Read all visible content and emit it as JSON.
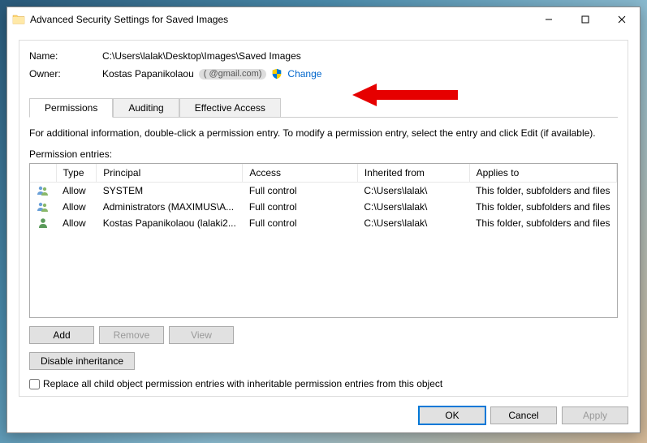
{
  "window": {
    "title": "Advanced Security Settings for Saved Images"
  },
  "name": {
    "label": "Name:",
    "value": "C:\\Users\\lalak\\Desktop\\Images\\Saved Images"
  },
  "owner": {
    "label": "Owner:",
    "value": "Kostas Papanikolaou",
    "email": "(           @gmail.com)",
    "change": "Change"
  },
  "tabs": {
    "permissions": "Permissions",
    "auditing": "Auditing",
    "effective": "Effective Access"
  },
  "instructions": "For additional information, double-click a permission entry. To modify a permission entry, select the entry and click Edit (if available).",
  "entries_label": "Permission entries:",
  "columns": {
    "type": "Type",
    "principal": "Principal",
    "access": "Access",
    "inherited": "Inherited from",
    "applies": "Applies to"
  },
  "entries": [
    {
      "type": "Allow",
      "principal": "SYSTEM",
      "access": "Full control",
      "inherited": "C:\\Users\\lalak\\",
      "applies": "This folder, subfolders and files",
      "icon": "group"
    },
    {
      "type": "Allow",
      "principal": "Administrators (MAXIMUS\\A...",
      "access": "Full control",
      "inherited": "C:\\Users\\lalak\\",
      "applies": "This folder, subfolders and files",
      "icon": "group"
    },
    {
      "type": "Allow",
      "principal": "Kostas Papanikolaou (lalaki2...",
      "access": "Full control",
      "inherited": "C:\\Users\\lalak\\",
      "applies": "This folder, subfolders and files",
      "icon": "user"
    }
  ],
  "buttons": {
    "add": "Add",
    "remove": "Remove",
    "view": "View",
    "disable_inherit": "Disable inheritance",
    "ok": "OK",
    "cancel": "Cancel",
    "apply": "Apply"
  },
  "checkbox_label": "Replace all child object permission entries with inheritable permission entries from this object"
}
